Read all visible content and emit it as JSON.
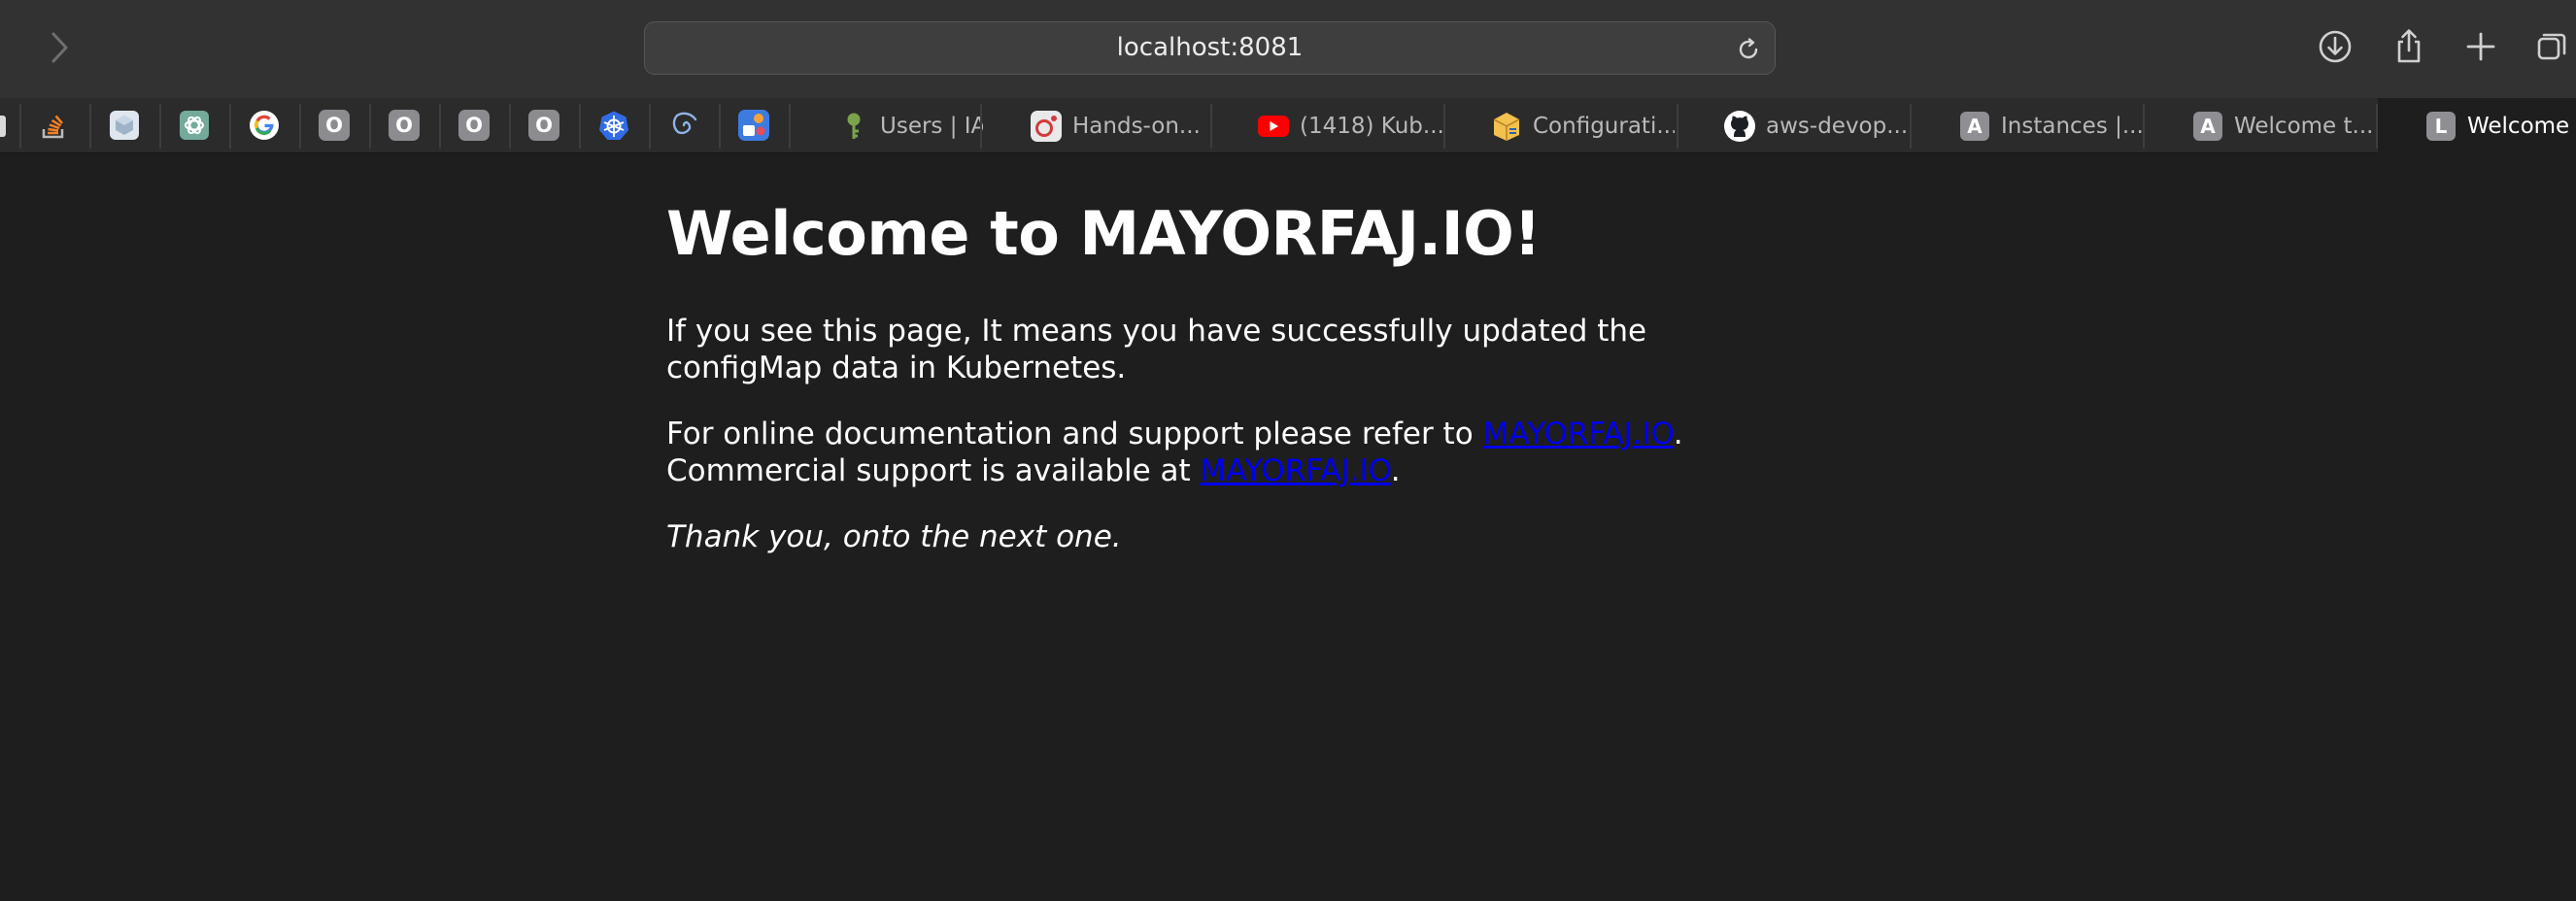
{
  "browser": {
    "url": "localhost:8081",
    "pinned_tabs": [
      {
        "icon": "stackoverflow-icon"
      },
      {
        "icon": "cube-app-icon"
      },
      {
        "icon": "chatgpt-icon"
      },
      {
        "icon": "google-icon"
      },
      {
        "icon": "letter-o-icon",
        "letter": "O"
      },
      {
        "icon": "letter-o-icon",
        "letter": "O"
      },
      {
        "icon": "letter-o-icon",
        "letter": "O"
      },
      {
        "icon": "letter-o-icon",
        "letter": "O"
      },
      {
        "icon": "kubernetes-icon"
      },
      {
        "icon": "spiral-icon"
      },
      {
        "icon": "app-icon"
      }
    ],
    "tabs": [
      {
        "title": "Users | IA...",
        "icon": "key-icon"
      },
      {
        "title": "Hands-on...",
        "icon": "udemy-icon"
      },
      {
        "title": "(1418) Kub...",
        "icon": "youtube-icon"
      },
      {
        "title": "Configurati...",
        "icon": "box-icon"
      },
      {
        "title": "aws-devop...",
        "icon": "github-icon"
      },
      {
        "title": "Instances |...",
        "icon": "letter-a-icon",
        "letter": "A"
      },
      {
        "title": "Welcome t...",
        "icon": "letter-a-icon",
        "letter": "A"
      },
      {
        "title": "Welcome t...",
        "icon": "letter-l-icon",
        "letter": "L"
      }
    ]
  },
  "page": {
    "heading": "Welcome to MAYORFAJ.IO!",
    "para1": "If you see this page, It means you have successfully updated the configMap data in Kubernetes.",
    "para2_prefix": "For online documentation and support please refer to ",
    "link1": "MAYORFAJ.IO",
    "para2_mid_suffix": ".",
    "para2_line2_prefix": "Commercial support is available at ",
    "link2": "MAYORFAJ.IO",
    "para2_end": ".",
    "closing": "Thank you, onto the next one."
  }
}
